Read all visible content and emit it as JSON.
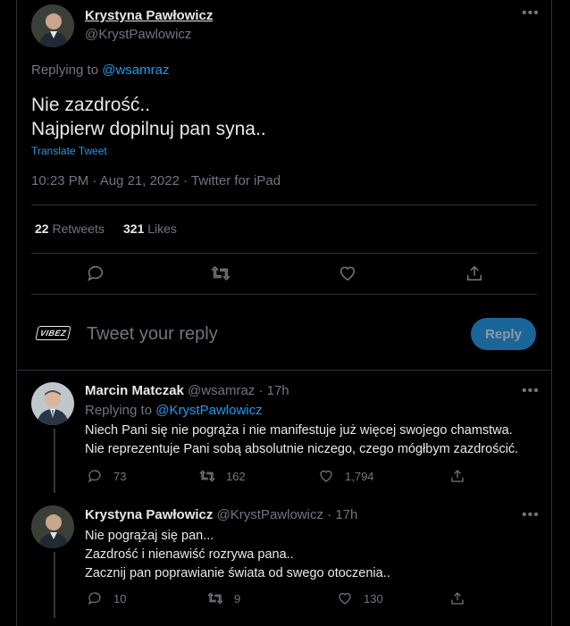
{
  "main_tweet": {
    "display_name": "Krystyna Pawłowicz",
    "handle": "@KrystPawlowicz",
    "replying_prefix": "Replying to",
    "replying_to": "@wsamraz",
    "text_line1": "Nie zazdrość..",
    "text_line2": "Najpierw dopilnuj pan syna..",
    "translate": "Translate Tweet",
    "meta": "10:23 PM · Aug 21, 2022 · Twitter for iPad",
    "retweets_count": "22",
    "retweets_label": "Retweets",
    "likes_count": "321",
    "likes_label": "Likes"
  },
  "composer": {
    "brand": "VIBEZ",
    "placeholder": "Tweet your reply",
    "reply_button": "Reply"
  },
  "replies": [
    {
      "display_name": "Marcin Matczak",
      "handle": "@wsamraz",
      "time": "· 17h",
      "replying_prefix": "Replying to",
      "replying_to": "@KrystPawlowicz",
      "line1": "Niech Pani się nie pogrąża i nie manifestuje już więcej swojego chamstwa.",
      "line2": "Nie reprezentuje Pani sobą absolutnie niczego, czego mógłbym zazdrościć.",
      "replies": "73",
      "retweets": "162",
      "likes": "1,794"
    },
    {
      "display_name": "Krystyna Pawłowicz",
      "handle": "@KrystPawlowicz",
      "time": "· 17h",
      "line1": "Nie pogrążaj się pan...",
      "line2": "Zazdrość i nienawiść rozrywa pana..",
      "line3": "Zacznij pan poprawianie świata od swego otoczenia..",
      "replies": "10",
      "retweets": "9",
      "likes": "130"
    }
  ],
  "colors": {
    "accent": "#1d9bf0",
    "muted": "#71767b",
    "border": "#2f3336",
    "reply_button_bg": "#1a6699"
  },
  "icons": [
    "more-icon",
    "reply-icon",
    "retweet-icon",
    "like-icon",
    "share-icon"
  ]
}
